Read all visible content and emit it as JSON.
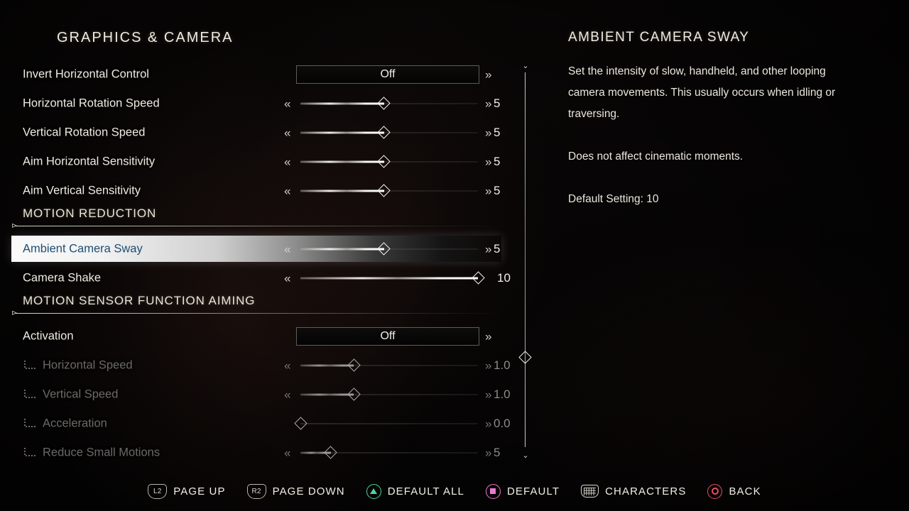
{
  "panel": {
    "title": "GRAPHICS & CAMERA"
  },
  "rows": [
    {
      "kind": "toggle",
      "label": "Invert Horizontal Control",
      "value": "Off",
      "right_arrow": true,
      "disabled": false
    },
    {
      "kind": "slider",
      "label": "Horizontal Rotation Speed",
      "value": "5",
      "fill": 47,
      "left_arrow": true,
      "right_arrow": true,
      "disabled": false
    },
    {
      "kind": "slider",
      "label": "Vertical Rotation Speed",
      "value": "5",
      "fill": 47,
      "left_arrow": true,
      "right_arrow": true,
      "disabled": false
    },
    {
      "kind": "slider",
      "label": "Aim Horizontal Sensitivity",
      "value": "5",
      "fill": 47,
      "left_arrow": true,
      "right_arrow": true,
      "disabled": false
    },
    {
      "kind": "slider",
      "label": "Aim Vertical Sensitivity",
      "value": "5",
      "fill": 47,
      "left_arrow": true,
      "right_arrow": true,
      "disabled": false
    },
    {
      "kind": "section",
      "label": "MOTION REDUCTION"
    },
    {
      "kind": "slider",
      "label": "Ambient Camera Sway",
      "value": "5",
      "fill": 47,
      "left_arrow": true,
      "right_arrow": true,
      "selected": true,
      "disabled": false
    },
    {
      "kind": "slider",
      "label": "Camera Shake",
      "value": "10",
      "fill": 100,
      "left_arrow": true,
      "right_arrow": false,
      "disabled": false
    },
    {
      "kind": "section",
      "label": "MOTION SENSOR FUNCTION AIMING"
    },
    {
      "kind": "toggle",
      "label": "Activation",
      "value": "Off",
      "right_arrow": true,
      "disabled": false
    },
    {
      "kind": "slider",
      "label": "Horizontal Speed",
      "value": "1.0",
      "fill": 30,
      "left_arrow": true,
      "right_arrow": true,
      "disabled": true,
      "sub": true
    },
    {
      "kind": "slider",
      "label": "Vertical Speed",
      "value": "1.0",
      "fill": 30,
      "left_arrow": true,
      "right_arrow": true,
      "disabled": true,
      "sub": true
    },
    {
      "kind": "slider",
      "label": "Acceleration",
      "value": "0.0",
      "fill": 0,
      "left_arrow": false,
      "right_arrow": true,
      "disabled": true,
      "sub": true
    },
    {
      "kind": "slider",
      "label": "Reduce Small Motions",
      "value": "5",
      "fill": 17,
      "left_arrow": true,
      "right_arrow": true,
      "disabled": true,
      "sub": true
    }
  ],
  "scrollbar": {
    "up_glyph": "⌄",
    "down_glyph": "⌄",
    "thumb_position_pct": 76
  },
  "description": {
    "title": "AMBIENT CAMERA SWAY",
    "paragraph1": "Set the intensity of slow, handheld, and other looping camera movements. This usually occurs when idling or traversing.",
    "paragraph2": "Does not affect cinematic moments.",
    "paragraph3": "Default Setting: 10"
  },
  "footer": {
    "items": [
      {
        "icon": "l2-button-icon",
        "glyph": "L2",
        "type": "shoulder",
        "label": "PAGE UP"
      },
      {
        "icon": "r2-button-icon",
        "glyph": "R2",
        "type": "shoulder",
        "label": "PAGE DOWN"
      },
      {
        "icon": "triangle-button-icon",
        "type": "triangle",
        "label": "DEFAULT ALL",
        "color": "#49d6a0"
      },
      {
        "icon": "square-button-icon",
        "type": "square",
        "label": "DEFAULT",
        "color": "#e87ad0"
      },
      {
        "icon": "touchpad-button-icon",
        "type": "touchpad",
        "label": "CHARACTERS",
        "color": "#ddd9d1"
      },
      {
        "icon": "circle-button-icon",
        "type": "circle",
        "label": "BACK",
        "color": "#ef4d63"
      }
    ]
  },
  "arrows": {
    "left": "«",
    "right": "»"
  }
}
